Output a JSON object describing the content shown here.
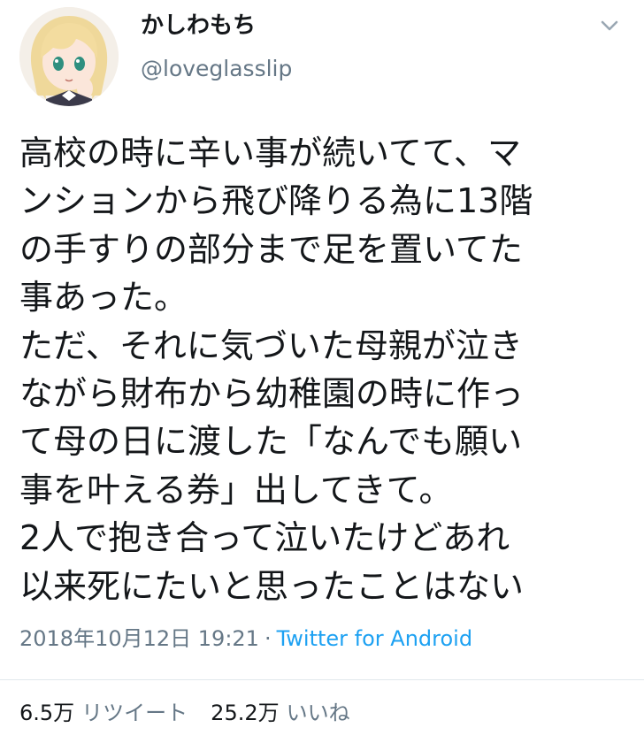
{
  "tweet": {
    "display_name": "かしわもち",
    "username": "@loveglasslip",
    "text_lines": [
      "高校の時に辛い事が続いてて、マ",
      "ンションから飛び降りる為に13階",
      "の手すりの部分まで足を置いてた",
      "事あった。",
      "ただ、それに気づいた母親が泣き",
      "ながら財布から幼稚園の時に作っ",
      "て母の日に渡した「なんでも願い",
      "事を叶える券」出してきて。",
      "2人で抱き合って泣いたけどあれ",
      "以来死にたいと思ったことはない"
    ],
    "timestamp": "2018年10月12日 19:21",
    "separator": "·",
    "client": "Twitter for Android",
    "retweets_count": "6.5万",
    "retweets_label": "リツイート",
    "likes_count": "25.2万",
    "likes_label": "いいね"
  },
  "icons": {
    "avatar": "anime-avatar",
    "menu": "chevron-down-icon"
  },
  "colors": {
    "text": "#14171a",
    "secondary": "#657786",
    "link": "#1da1f2",
    "divider": "#e1e8ed"
  }
}
